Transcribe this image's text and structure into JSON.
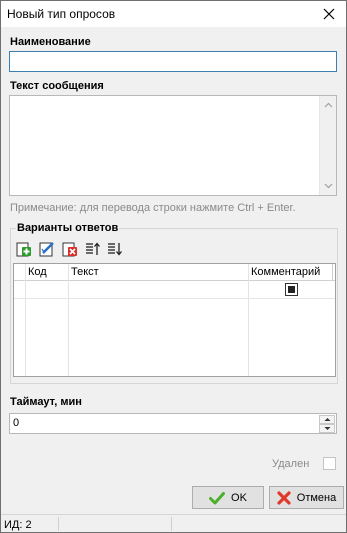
{
  "window": {
    "title": "Новый тип опросов"
  },
  "name_field": {
    "label": "Наименование",
    "value": ""
  },
  "message_field": {
    "label": "Текст сообщения",
    "value": ""
  },
  "hint": "Примечание: для перевода строки нажмите Ctrl + Enter.",
  "answers": {
    "legend": "Варианты ответов",
    "toolbar_icons": [
      "add-icon",
      "edit-icon",
      "delete-icon",
      "move-up-icon",
      "move-down-icon"
    ],
    "columns": [
      "Код",
      "Текст",
      "Комментарий"
    ],
    "rows": [
      {
        "code": "",
        "text": "",
        "comment": true
      }
    ]
  },
  "timeout": {
    "label": "Таймаут, мин",
    "value": "0"
  },
  "deleted": {
    "label": "Удален",
    "checked": false
  },
  "buttons": {
    "ok": "OK",
    "cancel": "Отмена"
  },
  "status": {
    "id_text": "ИД: 2"
  },
  "colors": {
    "focus_border": "#3c7fb1",
    "ok_icon": "#4caf2a",
    "cancel_icon": "#e0392a"
  }
}
